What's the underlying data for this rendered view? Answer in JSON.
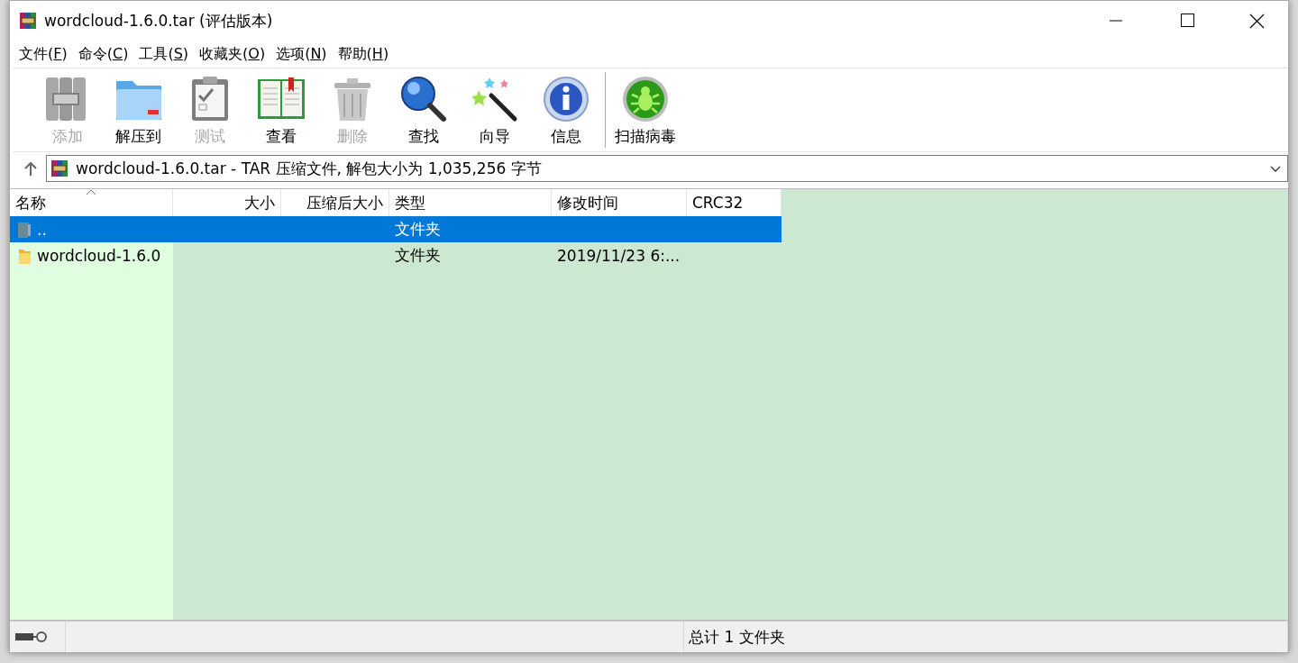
{
  "window": {
    "title": "wordcloud-1.6.0.tar (评估版本)"
  },
  "menu": [
    {
      "label": "文件(F)"
    },
    {
      "label": "命令(C)"
    },
    {
      "label": "工具(S)"
    },
    {
      "label": "收藏夹(O)"
    },
    {
      "label": "选项(N)"
    },
    {
      "label": "帮助(H)"
    }
  ],
  "toolbar": [
    {
      "label": "添加",
      "disabled": true
    },
    {
      "label": "解压到",
      "disabled": false
    },
    {
      "label": "测试",
      "disabled": true
    },
    {
      "label": "查看",
      "disabled": false
    },
    {
      "label": "删除",
      "disabled": true
    },
    {
      "label": "查找",
      "disabled": false
    },
    {
      "label": "向导",
      "disabled": false
    },
    {
      "label": "信息",
      "disabled": false
    },
    {
      "label": "扫描病毒",
      "disabled": false
    }
  ],
  "address": {
    "value": "wordcloud-1.6.0.tar - TAR 压缩文件, 解包大小为 1,035,256 字节"
  },
  "table": {
    "columns": [
      {
        "label": "名称",
        "sorted": true
      },
      {
        "label": "大小",
        "sorted": false
      },
      {
        "label": "压缩后大小",
        "sorted": false
      },
      {
        "label": "类型",
        "sorted": false
      },
      {
        "label": "修改时间",
        "sorted": false
      },
      {
        "label": "CRC32",
        "sorted": false
      }
    ],
    "rows": [
      {
        "name": "..",
        "type": "文件夹",
        "selected": true
      },
      {
        "name": "wordcloud-1.6.0",
        "type": "文件夹",
        "modified": "2019/11/23 6:...",
        "selected": false
      }
    ]
  },
  "status_bar": {
    "text": "总计 1 文件夹"
  }
}
